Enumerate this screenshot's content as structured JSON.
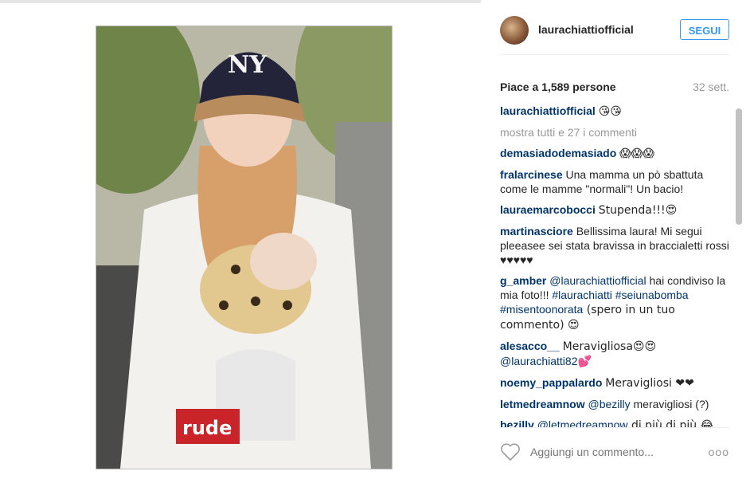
{
  "post": {
    "username": "laurachiattiofficial",
    "follow_label": "SEGUI",
    "likes": "Piace a 1,589 persone",
    "time": "32 sett.",
    "caption_user": "laurachiattiofficial",
    "caption_text": "😘😘",
    "show_all": "mostra tutti e 27 i commenti"
  },
  "comments": [
    {
      "user": "demasiadodemasiado",
      "text": "😱😱😱"
    },
    {
      "user": "fralarcinese",
      "text": "Una mamma un pò sbattuta come le mamme \"normali\"! Un bacio!"
    },
    {
      "user": "lauraemarcobocci",
      "text": "Stupenda!!!😍"
    },
    {
      "user": "martinasciore",
      "text": "Bellissima laura! Mi segui pleeasee sei stata bravissa in braccialetti rossi ♥♥♥♥♥"
    },
    {
      "user": "g_amber",
      "mention1": "@laurachiattiofficial",
      "text1": " hai condiviso la mia foto!!! ",
      "mention2": "#laurachiatti #seiunabomba #misentoonorata",
      "text2": " (spero in un tuo commento) 😍"
    },
    {
      "user": "alesacco__",
      "text1": "Meravigliosa😍😍 ",
      "mention": "@laurachiatti82",
      "text2": "💕"
    },
    {
      "user": "noemy_pappalardo",
      "text": "Meravigliosi ❤❤"
    },
    {
      "user": "letmedreamnow",
      "mention": "@bezilly",
      "text": " meravigliosi (?)"
    },
    {
      "user": "bezilly",
      "mention": "@letmedreamnow",
      "text": " di più di più 😂"
    }
  ],
  "footer": {
    "comment_placeholder": "Aggiungi un commento...",
    "more_label": "ooo"
  },
  "colors": {
    "accent": "#3897f0",
    "username": "#003569",
    "muted": "#999999"
  },
  "icons": {
    "like": "heart-outline-icon",
    "options": "more-options-icon"
  }
}
